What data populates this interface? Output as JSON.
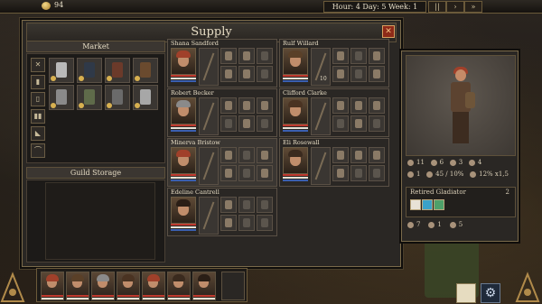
{
  "topbar": {
    "gold": "94",
    "date": "Hour: 4  Day: 5  Week: 1",
    "speed_buttons": [
      "||",
      "›",
      "»"
    ]
  },
  "window": {
    "title": "Supply",
    "close_label": "✕"
  },
  "market": {
    "header": "Market",
    "filters": [
      "✕",
      "▮",
      "▯",
      "▮▮",
      "◣",
      "⌒"
    ],
    "items": [
      {
        "color": "#b9b9b9"
      },
      {
        "color": "#2f3948"
      },
      {
        "color": "#6b3a2a"
      },
      {
        "color": "#6a4a2e"
      },
      {
        "color": "#8a8a8a"
      },
      {
        "color": "#5f6b4a"
      },
      {
        "color": "#6a6a6a"
      },
      {
        "color": "#a7a7a7"
      }
    ]
  },
  "guild_storage": {
    "header": "Guild Storage"
  },
  "mercenaries": [
    {
      "name": "Shana Sandford",
      "hair": "#a0402a",
      "highlight": false,
      "filled": [
        0,
        1,
        3,
        4
      ]
    },
    {
      "name": "Rulf Willard",
      "hair": "#5a4028",
      "highlight": false,
      "filled": [
        0,
        2,
        3,
        5
      ],
      "count": "10"
    },
    {
      "name": "Robert Becker",
      "hair": "#8a8a8a",
      "highlight": false,
      "filled": [
        0,
        1,
        2,
        4
      ]
    },
    {
      "name": "Clifford Clarke",
      "hair": "#4a3322",
      "highlight": false,
      "filled": [
        0,
        1,
        2,
        4
      ]
    },
    {
      "name": "Minerva Bristow",
      "hair": "#a0402a",
      "highlight": true,
      "filled": [
        0,
        2,
        3,
        5
      ]
    },
    {
      "name": "Eli Rosewall",
      "hair": "#3a2a1e",
      "highlight": false,
      "filled": [
        0,
        1,
        2,
        3
      ]
    },
    {
      "name": "Edeline Cantrell",
      "hair": "#2a1e16",
      "highlight": false,
      "filled": [
        0,
        3
      ]
    }
  ],
  "character": {
    "stats": {
      "row1": [
        "11",
        "6",
        "3",
        "4"
      ],
      "row2": [
        "1",
        "45 / 10%",
        "12% x1,5"
      ],
      "row3": [
        "7",
        "1",
        "5"
      ]
    },
    "class_name": "Retired Gladiator",
    "class_level": "2",
    "trait_colors": [
      "#e8e2d6",
      "#3aa2c8",
      "#4ea06a"
    ]
  },
  "party": {
    "hairs": [
      "#a0402a",
      "#5a4028",
      "#8a8a8a",
      "#4a3322",
      "#a0402a",
      "#3a2a1e",
      "#2a1e16"
    ]
  },
  "colors": {
    "accent": "#7a6a4a",
    "hp": "#c03a2f",
    "gold": "#d7b050"
  }
}
